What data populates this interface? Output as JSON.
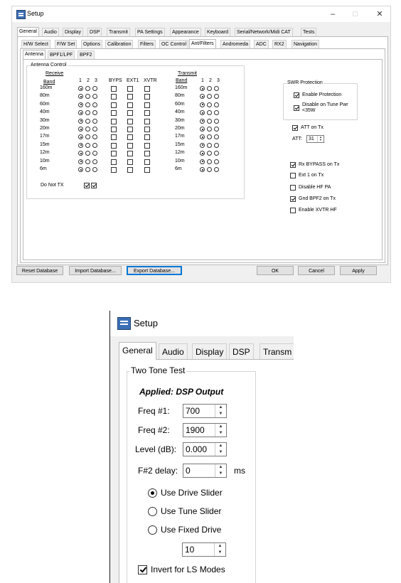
{
  "window": {
    "title": "Setup",
    "minimize": "–",
    "maximize": "□",
    "close": "✕"
  },
  "tabs_main": [
    "General",
    "Audio",
    "Display",
    "DSP",
    "Transmit",
    "PA Settings",
    "Appearance",
    "Keyboard",
    "Serial/Network/Midi CAT",
    "Tests"
  ],
  "tabs_sub": [
    "H/W Select",
    "F/W Set",
    "Options",
    "Calibration",
    "Filters",
    "OC Control",
    "Ant/Filters",
    "Andromeda",
    "ADC",
    "RX2",
    "Navigation"
  ],
  "tabs_inner": [
    "Antenna",
    "BPF1/LPF",
    "BPF2"
  ],
  "antenna": {
    "group_title": "Antenna Control",
    "receive_label": "Receive",
    "transmit_label": "Transmit",
    "band_label": "Band",
    "cols": [
      "1",
      "2",
      "3"
    ],
    "extra_cols": [
      "BYPS",
      "EXT1",
      "XVTR"
    ],
    "bands": [
      "160m",
      "80m",
      "60m",
      "40m",
      "30m",
      "20m",
      "17m",
      "15m",
      "12m",
      "10m",
      "6m"
    ],
    "do_not_tx": "Do Not TX"
  },
  "swr": {
    "title": "SWR Protection",
    "enable": "Enable Protection",
    "disable_tune": "Disable on Tune Pwr <35W"
  },
  "att": {
    "on_tx": "ATT on Tx",
    "label": "ATT:",
    "value": "31"
  },
  "options": {
    "rx_bypass": "Rx BYPASS on Tx",
    "ext1": "Ext 1 on Tx",
    "disable_hf_pa": "Disable HF PA",
    "gnd_bpf2": "Gnd BPF2 on Tx",
    "enable_xvtr": "Enable XVTR HF"
  },
  "buttons": {
    "reset": "Reset Database",
    "import": "Import Database...",
    "export": "Export Database...",
    "ok": "OK",
    "cancel": "Cancel",
    "apply": "Apply"
  },
  "zoom": {
    "title": "Setup",
    "tabs": [
      "General",
      "Audio",
      "Display",
      "DSP",
      "Transm"
    ],
    "group_title": "Two Tone Test",
    "applied": "Applied: DSP Output",
    "freq1_label": "Freq #1:",
    "freq1_value": "700",
    "freq2_label": "Freq #2:",
    "freq2_value": "1900",
    "level_label": "Level (dB):",
    "level_value": "0.000",
    "delay_label": "F#2 delay:",
    "delay_value": "0",
    "delay_unit": "ms",
    "drive_slider": "Use Drive Slider",
    "tune_slider": "Use Tune Slider",
    "fixed_drive": "Use Fixed Drive",
    "fixed_value": "10",
    "invert": "Invert for LS Modes"
  }
}
